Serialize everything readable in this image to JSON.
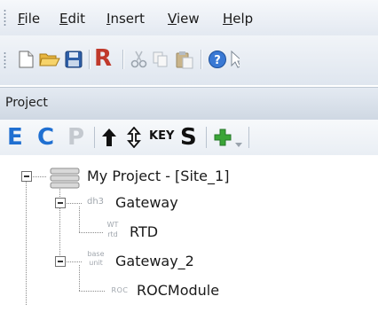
{
  "menubar": {
    "items": [
      {
        "pre": "",
        "acc": "F",
        "post": "ile"
      },
      {
        "pre": "",
        "acc": "E",
        "post": "dit"
      },
      {
        "pre": "",
        "acc": "I",
        "post": "nsert"
      },
      {
        "pre": "",
        "acc": "V",
        "post": "iew"
      },
      {
        "pre": "",
        "acc": "H",
        "post": "elp"
      }
    ]
  },
  "toolbar": {
    "r_label": "R",
    "icons": [
      "new-file-icon",
      "open-folder-icon",
      "save-icon",
      "r-icon",
      "cut-icon",
      "copy-icon",
      "paste-icon",
      "help-icon",
      "pointer-icon"
    ]
  },
  "project_panel": {
    "title": "Project",
    "buttons": {
      "e": "E",
      "c": "C",
      "p": "P",
      "key": "KEY",
      "s": "S"
    }
  },
  "tree": {
    "root": {
      "label": "My Project - [Site_1]"
    },
    "nodes": [
      {
        "label": "Gateway",
        "tag": "dh3"
      },
      {
        "label": "RTD",
        "tag_top": "WT",
        "tag_bottom": "rtd"
      },
      {
        "label": "Gateway_2",
        "tag_top": "base",
        "tag_bottom": "unit"
      },
      {
        "label": "ROCModule",
        "tag": "ROC"
      }
    ]
  },
  "colors": {
    "accent_blue": "#1f6fd1",
    "red": "#c0392b",
    "green": "#3aa537"
  }
}
